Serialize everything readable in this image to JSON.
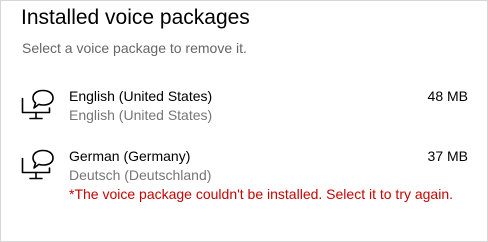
{
  "header": {
    "title": "Installed voice packages",
    "subtitle": "Select a voice package to remove it."
  },
  "packages": [
    {
      "name": "English (United States)",
      "native_name": "English (United States)",
      "size": "48 MB",
      "icon": "speech-monitor-icon"
    },
    {
      "name": "German (Germany)",
      "native_name": "Deutsch (Deutschland)",
      "size": "37 MB",
      "icon": "speech-monitor-icon",
      "error": "*The voice package couldn't be installed. Select it to try again."
    }
  ],
  "colors": {
    "error": "#c50500",
    "secondary_text": "#767676",
    "subtitle_text": "#666666"
  }
}
